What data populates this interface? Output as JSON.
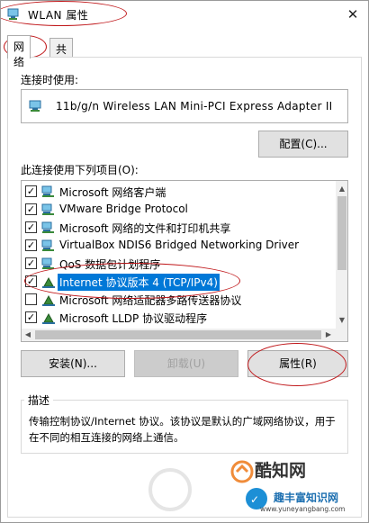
{
  "window": {
    "title": "WLAN 属性",
    "close_glyph": "✕"
  },
  "tabs": [
    {
      "label": "网络"
    },
    {
      "label": "共享"
    }
  ],
  "connect_using": {
    "label": "连接时使用:",
    "adapter": "11b/g/n  Wireless LAN Mini-PCI Express Adapter II"
  },
  "buttons": {
    "configure": "配置(C)...",
    "install": "安装(N)...",
    "uninstall": "卸载(U)",
    "properties": "属性(R)"
  },
  "items_label": "此连接使用下列项目(O):",
  "items": [
    {
      "label": "Microsoft 网络客户端",
      "checked": "✓",
      "icon": "client-icon"
    },
    {
      "label": "VMware Bridge Protocol",
      "checked": "✓",
      "icon": "service-icon"
    },
    {
      "label": "Microsoft 网络的文件和打印机共享",
      "checked": "✓",
      "icon": "service-icon"
    },
    {
      "label": "VirtualBox NDIS6 Bridged Networking Driver",
      "checked": "✓",
      "icon": "service-icon"
    },
    {
      "label": "QoS 数据包计划程序",
      "checked": "✓",
      "icon": "service-icon"
    },
    {
      "label": "Internet 协议版本 4 (TCP/IPv4)",
      "checked": "✓",
      "icon": "protocol-icon"
    },
    {
      "label": "Microsoft 网络适配器多路传送器协议",
      "checked": "",
      "icon": "protocol-icon"
    },
    {
      "label": "Microsoft LLDP 协议驱动程序",
      "checked": "✓",
      "icon": "protocol-icon"
    }
  ],
  "description": {
    "title": "描述",
    "text": "传输控制协议/Internet 协议。该协议是默认的广域网络协议，用于在不同的相互连接的网络上通信。"
  },
  "watermark": {
    "brand": "酷知网",
    "site": "趣丰富知识网",
    "url": "www.yuneyangbang.com"
  },
  "colors": {
    "selection": "#0078d7",
    "annotation": "#c0181b"
  }
}
